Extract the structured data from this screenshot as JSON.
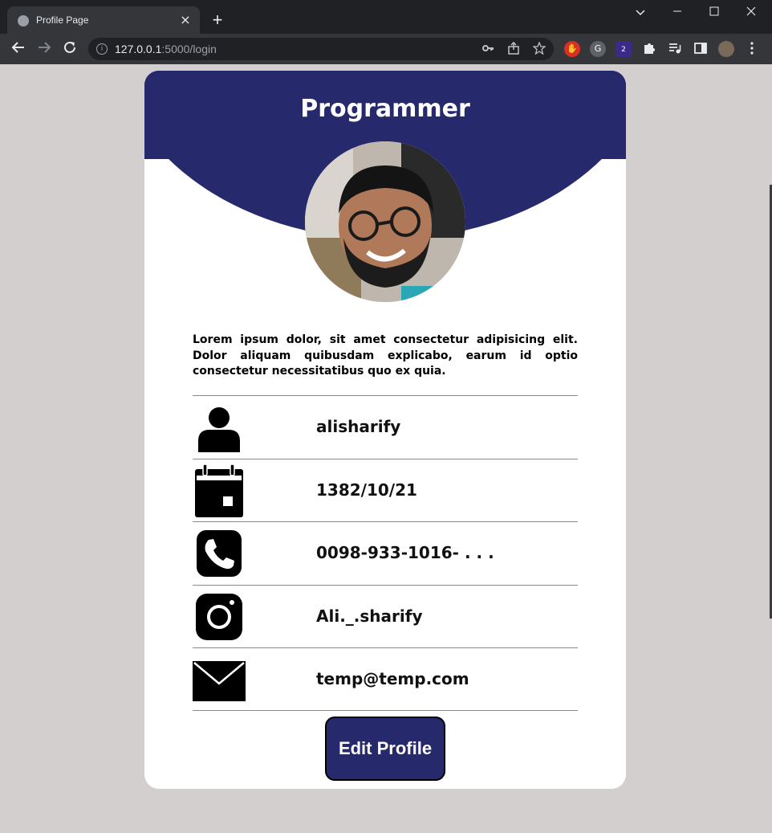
{
  "browser": {
    "tab_title": "Profile Page",
    "tab_close": "×",
    "new_tab": "+",
    "url_host": "127.0.0.1",
    "url_path": ":5000/login",
    "extension_badge": "2"
  },
  "profile": {
    "title": "Programmer",
    "bio": "Lorem ipsum dolor, sit amet consectetur adipisicing elit. Dolor aliquam quibusdam explicabo, earum id optio consectetur necessitatibus quo ex quia.",
    "username": "alisharify",
    "birthdate": "1382/10/21",
    "phone": "0098-933-1016- . . .",
    "instagram": "Ali._.sharify",
    "email": "temp@temp.com",
    "edit_button": "Edit Profile"
  },
  "icons": {
    "user": "user-icon",
    "calendar": "calendar-icon",
    "phone": "phone-icon",
    "instagram": "instagram-icon",
    "email": "envelope-icon"
  },
  "colors": {
    "accent": "#27296d",
    "page_background": "#d3cfcf",
    "card_background": "#ffffff"
  }
}
